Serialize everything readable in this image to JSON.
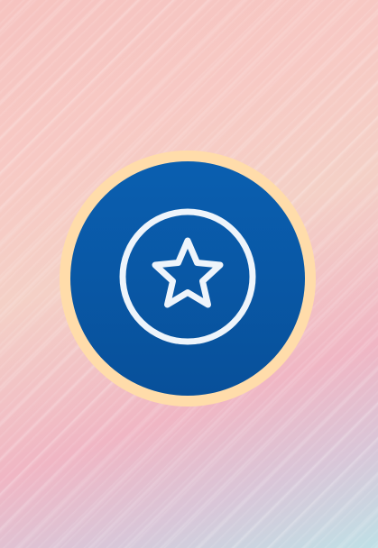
{
  "background": {
    "colors": [
      "#f6c3c0",
      "#f4d0c6",
      "#f0b6c4",
      "#bfe0e6"
    ]
  },
  "badge": {
    "icon": "star-in-circle-icon",
    "ring_color": "#ffdcaa",
    "fill_color_top": "#0a5fb0",
    "fill_color_bottom": "#08509a",
    "icon_color": "#eef4fb"
  }
}
